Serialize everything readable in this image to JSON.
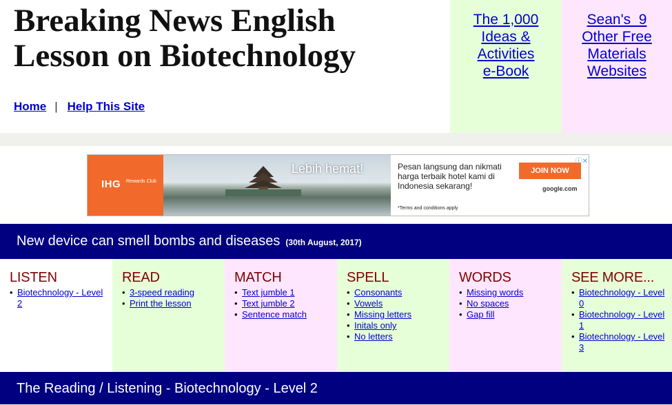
{
  "header": {
    "title_line1": "Breaking News English",
    "title_line2": "Lesson on Biotechnology",
    "nav": {
      "home": "Home",
      "separator": "|",
      "help": "Help This Site"
    },
    "promo_ebook": {
      "line1": "The 1,000",
      "line2": "Ideas &",
      "line3": "Activities",
      "line4": "e-Book"
    },
    "promo_sites": {
      "line1": "Sean's  9",
      "line2": "Other Free",
      "line3": "Materials",
      "line4": "Websites"
    }
  },
  "ad": {
    "logo": "IHG",
    "logo_sub": "Rewards Club",
    "headline": "Lebih hemat!",
    "body": "Pesan langsung dan nikmati harga terbaik hotel kami di Indonesia sekarang!",
    "terms": "*Terms and conditions apply",
    "cta": "JOIN NOW",
    "domain": "google.com",
    "info_icon": "info-icon"
  },
  "news": {
    "headline": "New device can smell bombs and diseases",
    "date": "(30th August, 2017)"
  },
  "sections": [
    {
      "title": "LISTEN",
      "items": [
        "Biotechnology - Level 2"
      ]
    },
    {
      "title": "READ",
      "items": [
        "3-speed reading",
        "Print the lesson"
      ]
    },
    {
      "title": "MATCH",
      "items": [
        "Text jumble 1",
        "Text jumble 2",
        "Sentence match"
      ]
    },
    {
      "title": "SPELL",
      "items": [
        "Consonants",
        "Vowels",
        "Missing letters",
        "Initals only",
        "No letters"
      ]
    },
    {
      "title": "WORDS",
      "items": [
        "Missing words",
        "No spaces",
        "Gap fill"
      ]
    },
    {
      "title": "SEE MORE...",
      "items": [
        "Biotechnology - Level 0",
        "Biotechnology - Level 1",
        "Biotechnology - Level 3"
      ]
    }
  ],
  "reading_bar": "The Reading / Listening - Biotechnology - Level 2"
}
